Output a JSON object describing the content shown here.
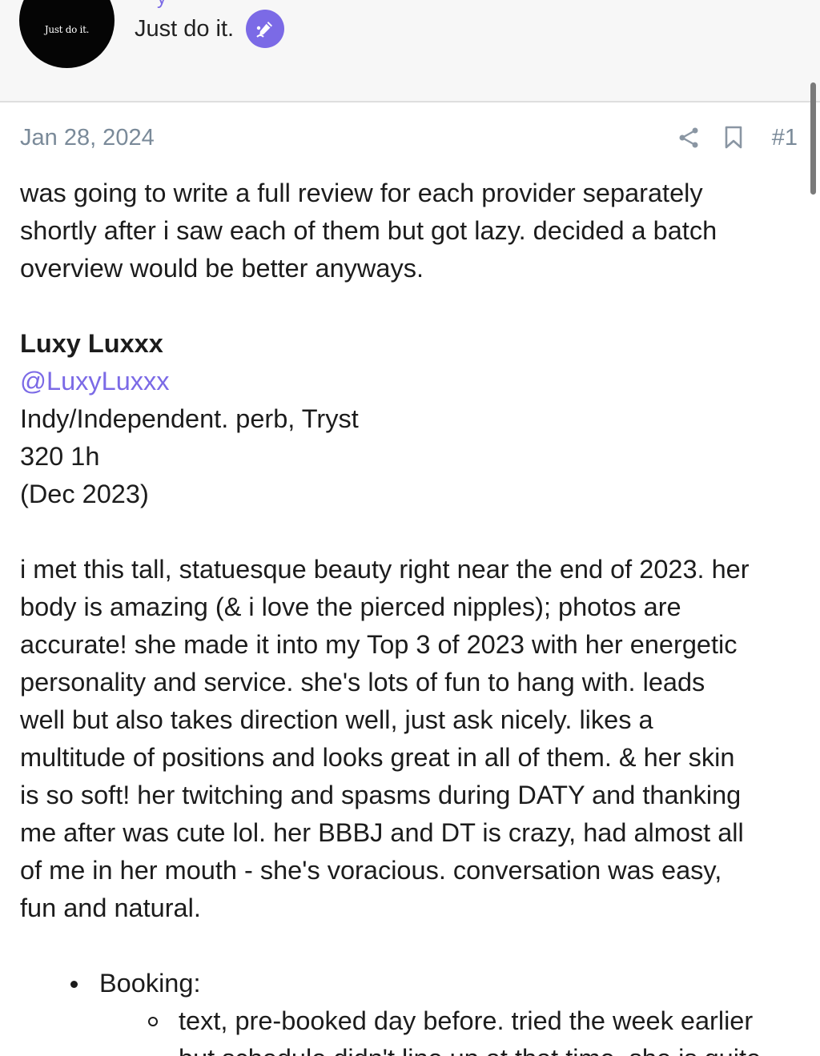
{
  "header": {
    "avatar_text": "Just do it.",
    "user_title": "Just do it.",
    "username_fragment": "y"
  },
  "post": {
    "date": "Jan 28, 2024",
    "number": "#1",
    "intro_lines": [
      "was going to write a full review for each provider separately",
      "shortly after i saw each of them but got lazy. decided a batch",
      "overview would be better anyways."
    ],
    "provider_name": "Luxy Luxxx",
    "provider_mention": "@LuxyLuxxx",
    "provider_type": "Indy/Independent. perb, Tryst",
    "provider_rate": "320 1h",
    "provider_date": "(Dec 2023)",
    "review_lines": [
      "i met this tall, statuesque beauty right near the end of 2023. her",
      "body is amazing (& i love the pierced nipples); photos are",
      "accurate! she made it into my Top 3 of 2023 with her energetic",
      "personality and service. she's lots of fun to hang with. leads",
      "well but also takes direction well, just ask nicely. likes a",
      "multitude of positions and looks great in all of them. & her skin",
      "is so soft! her twitching and spasms during DATY and thanking",
      "me after was cute lol. her BBBJ and DT is crazy, had almost all",
      "of me in her mouth - she's voracious. conversation was easy,",
      "fun and natural."
    ],
    "booking_label": "Booking:",
    "booking_sub_lines": [
      "text, pre-booked day before. tried the week earlier",
      "but schedule didn't line up at that time. she is quite"
    ]
  },
  "colors": {
    "accent": "#7b6ae6",
    "meta": "#7a8a99",
    "header_bg": "#f7f7f7"
  },
  "icons": [
    "pencil-badge-icon",
    "share-icon",
    "bookmark-icon"
  ]
}
